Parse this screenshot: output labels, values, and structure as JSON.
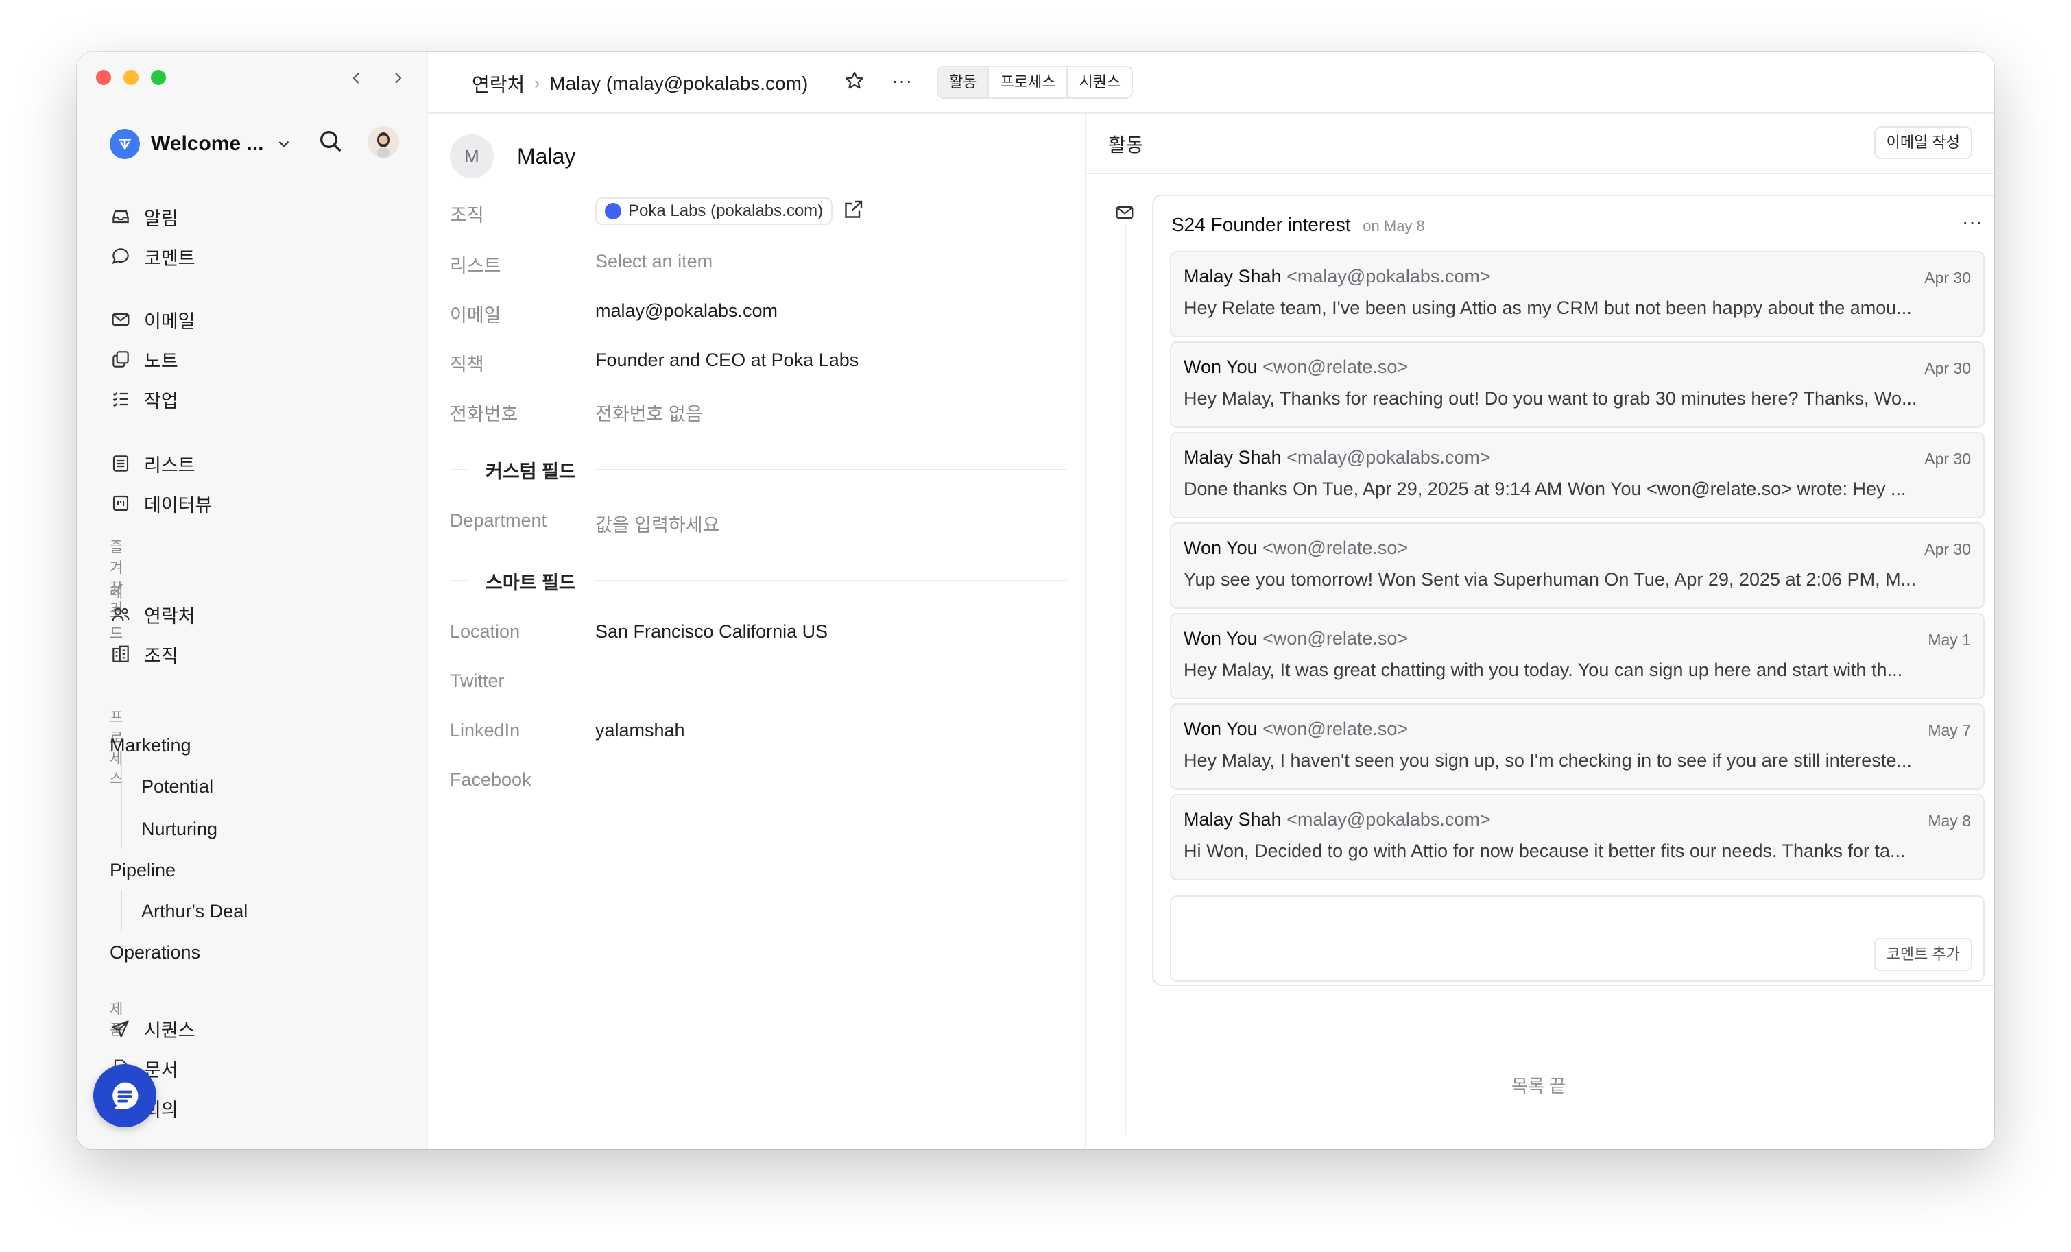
{
  "sidebar": {
    "workspace_name": "Welcome ...",
    "nav_top": [
      {
        "label": "알림",
        "icon": "inbox-icon"
      },
      {
        "label": "코멘트",
        "icon": "comment-icon"
      }
    ],
    "nav_mid": [
      {
        "label": "이메일",
        "icon": "mail-icon"
      },
      {
        "label": "노트",
        "icon": "notes-icon"
      },
      {
        "label": "작업",
        "icon": "tasks-icon"
      }
    ],
    "nav_lists": [
      {
        "label": "리스트",
        "icon": "list-icon"
      },
      {
        "label": "데이터뷰",
        "icon": "dataview-icon"
      }
    ],
    "favorites_label": "즐겨찾기",
    "records_label": "레코드",
    "records": [
      {
        "label": "연락처",
        "icon": "people-icon"
      },
      {
        "label": "조직",
        "icon": "building-icon"
      }
    ],
    "process_label": "프로세스",
    "processes": [
      {
        "label": "Marketing",
        "children": [
          "Potential",
          "Nurturing"
        ]
      },
      {
        "label": "Pipeline",
        "children": [
          "Arthur's Deal"
        ]
      },
      {
        "label": "Operations",
        "children": []
      }
    ],
    "product_label": "제품",
    "products": [
      {
        "label": "시퀀스",
        "icon": "send-icon"
      },
      {
        "label": "문서",
        "icon": "document-icon"
      },
      {
        "label": "회의",
        "icon": "calendar-icon"
      }
    ]
  },
  "header": {
    "breadcrumb_root": "연락처",
    "breadcrumb_current": "Malay (malay@pokalabs.com)",
    "tabs": [
      "활동",
      "프로세스",
      "시퀀스"
    ]
  },
  "contact": {
    "avatar_initial": "M",
    "name": "Malay",
    "fields": [
      {
        "label": "조직",
        "value": "Poka Labs (pokalabs.com)"
      },
      {
        "label": "리스트",
        "value": "Select an item"
      },
      {
        "label": "이메일",
        "value": "malay@pokalabs.com"
      },
      {
        "label": "직책",
        "value": "Founder and CEO at Poka Labs"
      },
      {
        "label": "전화번호",
        "value": "전화번호 없음"
      }
    ],
    "custom_section_title": "커스텀 필드",
    "custom_fields": [
      {
        "label": "Department",
        "value": "값을 입력하세요"
      }
    ],
    "smart_section_title": "스마트 필드",
    "smart_fields": [
      {
        "label": "Location",
        "value": "San Francisco California US"
      },
      {
        "label": "Twitter",
        "value": ""
      },
      {
        "label": "LinkedIn",
        "value": "yalamshah"
      },
      {
        "label": "Facebook",
        "value": ""
      }
    ]
  },
  "activity": {
    "title": "활동",
    "compose_label": "이메일 작성",
    "thread_title": "S24 Founder interest",
    "thread_date": "on May 8",
    "emails": [
      {
        "name": "Malay Shah",
        "addr": "<malay@pokalabs.com>",
        "date": "Apr 30",
        "snippet": "Hey Relate team, I've been using Attio as my CRM but not been happy about the amou..."
      },
      {
        "name": "Won You",
        "addr": "<won@relate.so>",
        "date": "Apr 30",
        "snippet": "Hey Malay, Thanks for reaching out! Do you want to grab 30 minutes here? Thanks, Wo..."
      },
      {
        "name": "Malay Shah",
        "addr": "<malay@pokalabs.com>",
        "date": "Apr 30",
        "snippet": "Done thanks On Tue, Apr 29, 2025 at 9:14 AM Won You <won@relate.so> wrote: Hey ..."
      },
      {
        "name": "Won You",
        "addr": "<won@relate.so>",
        "date": "Apr 30",
        "snippet": "Yup see you tomorrow! Won Sent via Superhuman On Tue, Apr 29, 2025 at 2:06 PM, M..."
      },
      {
        "name": "Won You",
        "addr": "<won@relate.so>",
        "date": "May 1",
        "snippet": "Hey Malay, It was great chatting with you today. You can sign up here and start with th..."
      },
      {
        "name": "Won You",
        "addr": "<won@relate.so>",
        "date": "May 7",
        "snippet": "Hey Malay, I haven't seen you sign up, so I'm checking in to see if you are still intereste..."
      },
      {
        "name": "Malay Shah",
        "addr": "<malay@pokalabs.com>",
        "date": "May 8",
        "snippet": "Hi Won, Decided to go with Attio for now because it better fits our needs. Thanks for ta..."
      }
    ],
    "comment_button": "코멘트 추가",
    "list_end": "목록 끝"
  }
}
